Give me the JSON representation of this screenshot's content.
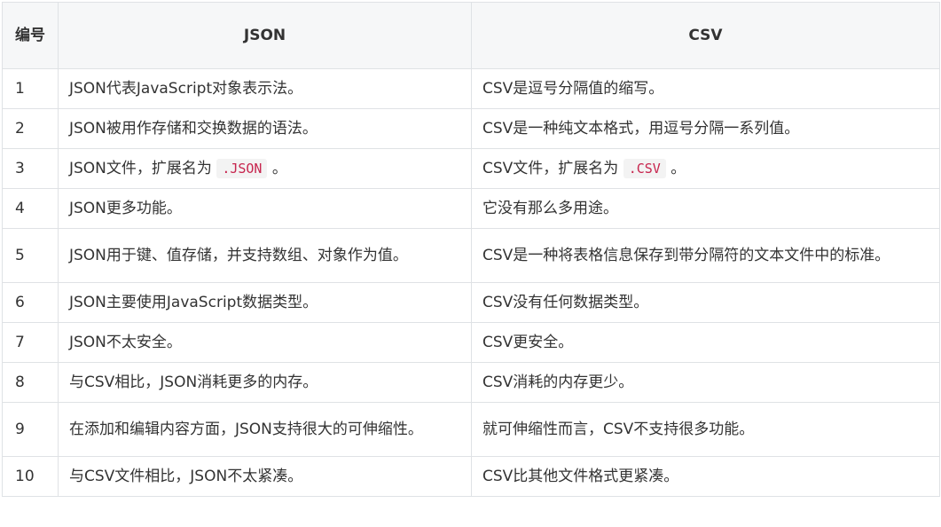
{
  "table": {
    "headers": {
      "num": "编号",
      "json": "JSON",
      "csv": "CSV"
    },
    "rows": [
      {
        "num": "1",
        "json": "JSON代表JavaScript对象表示法。",
        "csv": "CSV是逗号分隔值的缩写。"
      },
      {
        "num": "2",
        "json": "JSON被用作存储和交换数据的语法。",
        "csv": "CSV是一种纯文本格式，用逗号分隔一系列值。"
      },
      {
        "num": "3",
        "json_prefix": "JSON文件，扩展名为",
        "json_code": ".JSON",
        "json_suffix": "。",
        "csv_prefix": "CSV文件，扩展名为",
        "csv_code": ".CSV",
        "csv_suffix": "。"
      },
      {
        "num": "4",
        "json": "JSON更多功能。",
        "csv": "它没有那么多用途。"
      },
      {
        "num": "5",
        "json": "JSON用于键、值存储，并支持数组、对象作为值。",
        "csv": "CSV是一种将表格信息保存到带分隔符的文本文件中的标准。"
      },
      {
        "num": "6",
        "json": "JSON主要使用JavaScript数据类型。",
        "csv": "CSV没有任何数据类型。"
      },
      {
        "num": "7",
        "json": "JSON不太安全。",
        "csv": "CSV更安全。"
      },
      {
        "num": "8",
        "json": "与CSV相比，JSON消耗更多的内存。",
        "csv": "CSV消耗的内存更少。"
      },
      {
        "num": "9",
        "json": "在添加和编辑内容方面，JSON支持很大的可伸缩性。",
        "csv": "就可伸缩性而言，CSV不支持很多功能。"
      },
      {
        "num": "10",
        "json": "与CSV文件相比，JSON不太紧凑。",
        "csv": "CSV比其他文件格式更紧凑。"
      }
    ]
  }
}
